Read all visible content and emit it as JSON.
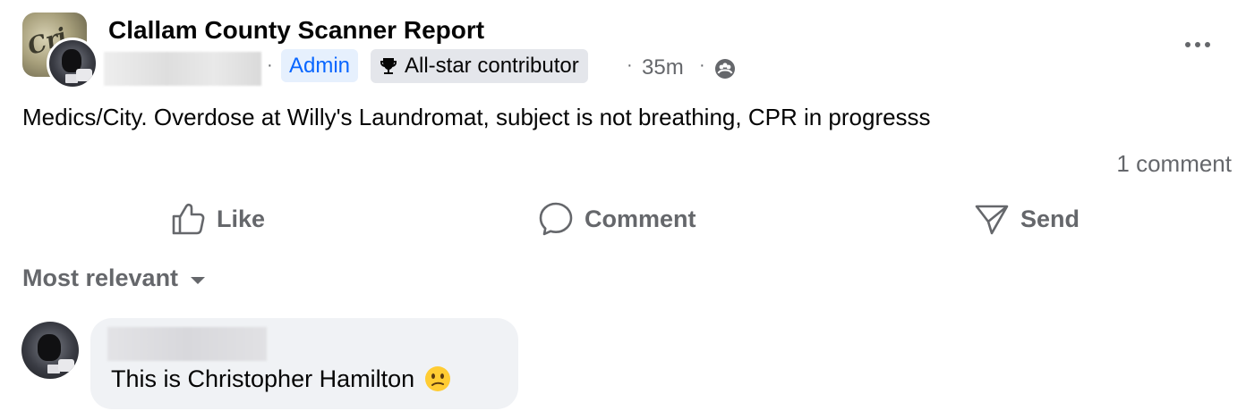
{
  "post": {
    "group_name": "Clallam County Scanner Report",
    "admin_label": "Admin",
    "badge_label": "All-star contributor",
    "timestamp": "35m",
    "separator": "·",
    "text": "Medics/City. Overdose at Willy's Laundromat, subject is not breathing, CPR in progresss",
    "comment_count": "1 comment"
  },
  "actions": {
    "like_label": "Like",
    "comment_label": "Comment",
    "send_label": "Send"
  },
  "comments": {
    "sort_label": "Most relevant",
    "items": [
      {
        "text": "This is Christopher Hamilton",
        "emoji": "face-confused-icon"
      }
    ]
  },
  "icons": {
    "more": "more-options-icon",
    "trophy": "trophy-icon",
    "audience": "group-audience-icon",
    "like": "thumbs-up-icon",
    "comment": "speech-bubble-icon",
    "send": "send-icon",
    "sort": "chevron-down-icon"
  },
  "colors": {
    "admin_text": "#0866ff",
    "admin_bg": "#e6f0fd",
    "secondary_text": "#65676b",
    "badge_bg": "#e4e6eb",
    "bubble_bg": "#f0f2f5"
  }
}
